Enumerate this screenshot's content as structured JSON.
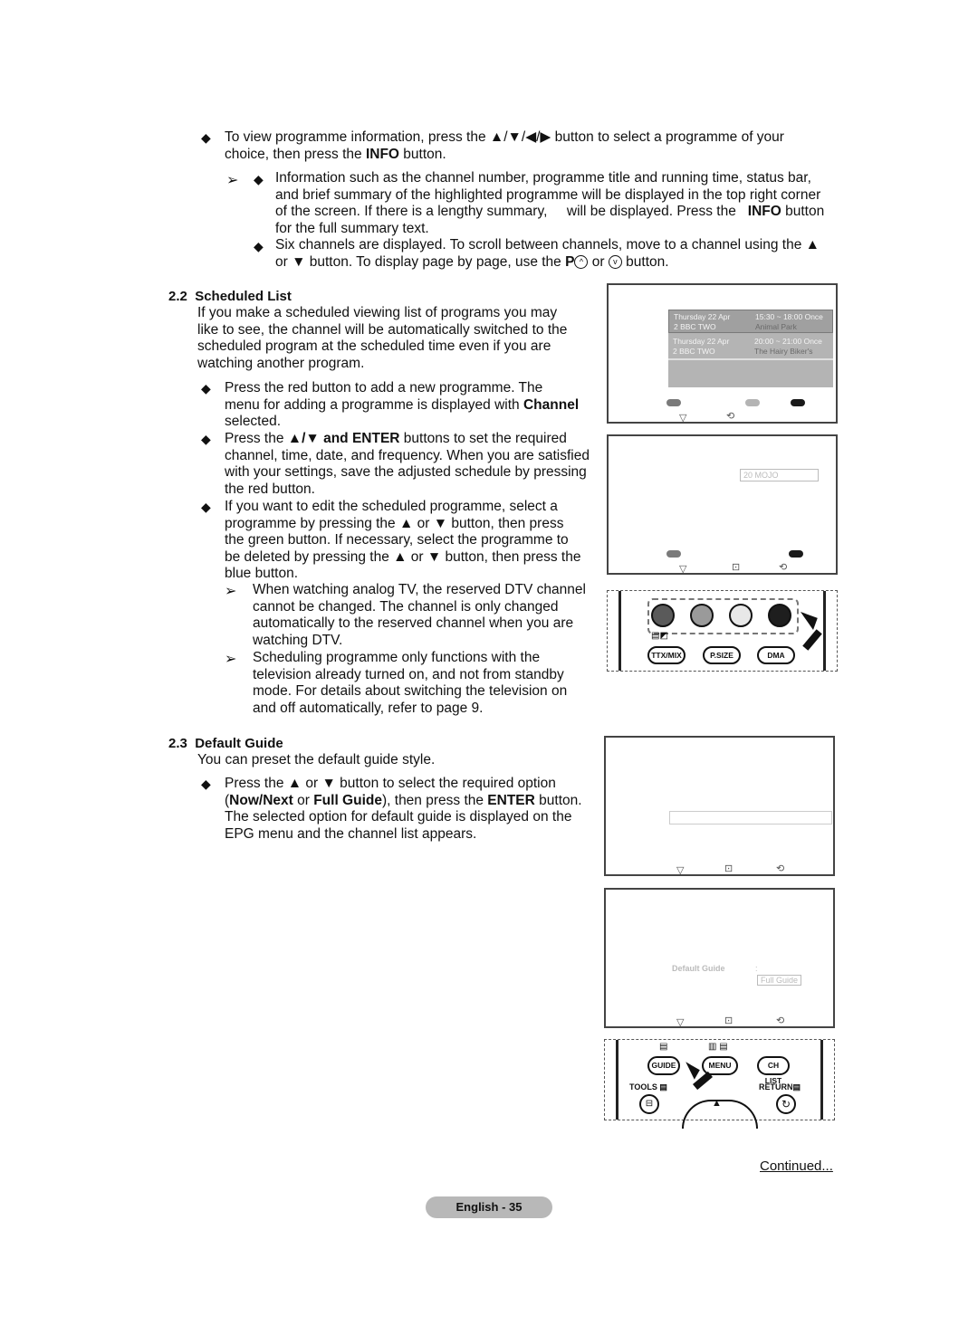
{
  "intro": {
    "bullet1": {
      "pre": "To view programme information, press the ",
      "arrows": "▲/▼/◀/▶",
      "mid": " button to select a programme of your",
      "line2_pre": "choice, then press the ",
      "info": "INFO",
      "line2_post": " button."
    },
    "note": {
      "line1": "Information such as the channel number, programme title and running time, status bar,",
      "line2": "and brief summary of the highlighted programme will be displayed in the top right corner",
      "line3_pre": "of the screen. If there is a lengthy summary,     will be displayed. Press the   ",
      "info": "INFO",
      "line3_post": " button",
      "line4": "for the full summary text."
    },
    "bullet2": {
      "line1": "Six channels are displayed. To scroll between channels, move to a channel using the ▲",
      "line2_pre": "or ▼ button. To display page by page, use the ",
      "p": "P",
      "or": " or ",
      "post": " button."
    }
  },
  "section22": {
    "number": "2.2",
    "title": "Scheduled List",
    "para": [
      "If you make a scheduled viewing list of programs you may",
      "like to see, the channel will be automatically switched to the",
      "scheduled program at the scheduled time even if you are",
      "watching another program."
    ],
    "b1": [
      "Press the red button to add a new programme. The",
      "menu for adding a programme is displayed with ",
      "Channel",
      "selected."
    ],
    "b2": [
      "Press the ",
      "▲/▼ and ENTER",
      " buttons to set the required",
      "channel, time, date, and frequency. When you are satisfied",
      "with your settings, save the adjusted schedule by pressing",
      "the red button."
    ],
    "b3": [
      "If you want to edit the scheduled programme, select a",
      "programme by pressing the ▲ or ▼ button, then press",
      "the green button. If necessary, select the programme to",
      "be deleted by pressing the ▲ or ▼ button, then press the",
      "blue button."
    ],
    "n1": [
      "When watching analog TV, the reserved DTV channel",
      "cannot be changed. The channel is only changed",
      "automatically to the reserved channel when you are",
      "watching DTV."
    ],
    "n2": [
      "Scheduling programme only functions with the",
      "television already turned on, and not from standby",
      "mode. For details about switching the television on",
      "and off automatically, refer to page 9."
    ]
  },
  "section23": {
    "number": "2.3",
    "title": "Default Guide",
    "para": "You can preset the default guide style.",
    "b1_l1": "Press the ▲ or ▼ button to select the required option",
    "b1_l2_a": "(",
    "b1_l2_nownext": "Now/Next",
    "b1_l2_or": " or ",
    "b1_l2_full": "Full Guide",
    "b1_l2_mid": "), then press the ",
    "b1_l2_enter": "ENTER",
    "b1_l2_end": " button.",
    "b1_l3": "The selected option for default guide is displayed on the",
    "b1_l4": "EPG menu and the channel list appears."
  },
  "screen1": {
    "rows": [
      {
        "date": "Thursday 22 Apr",
        "time": "15:30 ~ 18:00 Once",
        "channel": "2 BBC TWO",
        "title": "Animal Park",
        "selected": true
      },
      {
        "date": "Thursday 22 Apr",
        "time": "20:00 ~ 21:00 Once",
        "channel": "2 BBC TWO",
        "title": "The Hairy Biker's",
        "selected": false
      }
    ],
    "button_colors": [
      "#7a7a7a",
      "#b4b4b4",
      "#1a1a1a"
    ]
  },
  "screen2": {
    "channel_field": "20  MOJO",
    "button_colors": [
      "#7a7a7a",
      "#1a1a1a"
    ]
  },
  "screen4": {
    "label": "Default Guide",
    "colon": ":",
    "value": "Full Guide"
  },
  "remote1": {
    "color_buttons": [
      "#5a5a5a",
      "#9a9a9a",
      "#e8e8e8",
      "#1e1e1e"
    ],
    "buttons": [
      "TTX/MIX",
      "P.SIZE",
      "DMA"
    ]
  },
  "remote2": {
    "buttons": [
      "GUIDE",
      "MENU",
      "CH LIST"
    ],
    "tools": "TOOLS",
    "return": "RETURN"
  },
  "footer": {
    "continued": "Continued...",
    "page": "English - 35"
  }
}
